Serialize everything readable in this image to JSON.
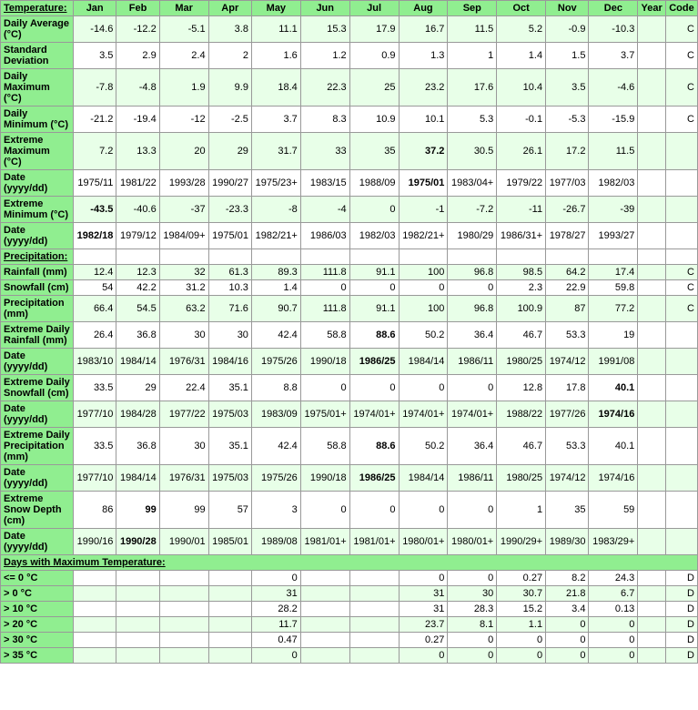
{
  "table": {
    "title": "Temperature:",
    "columns": [
      "Jan",
      "Feb",
      "Mar",
      "Apr",
      "May",
      "Jun",
      "Jul",
      "Aug",
      "Sep",
      "Oct",
      "Nov",
      "Dec",
      "Year",
      "Code"
    ],
    "rows": [
      {
        "label": "Daily Average (°C)",
        "values": [
          "-14.6",
          "-12.2",
          "-5.1",
          "3.8",
          "11.1",
          "15.3",
          "17.9",
          "16.7",
          "11.5",
          "5.2",
          "-0.9",
          "-10.3",
          "",
          "C"
        ],
        "bold": [],
        "bg": "alt"
      },
      {
        "label": "Standard Deviation",
        "values": [
          "3.5",
          "2.9",
          "2.4",
          "2",
          "1.6",
          "1.2",
          "0.9",
          "1.3",
          "1",
          "1.4",
          "1.5",
          "3.7",
          "",
          "C"
        ],
        "bold": [],
        "bg": "normal"
      },
      {
        "label": "Daily Maximum (°C)",
        "values": [
          "-7.8",
          "-4.8",
          "1.9",
          "9.9",
          "18.4",
          "22.3",
          "25",
          "23.2",
          "17.6",
          "10.4",
          "3.5",
          "-4.6",
          "",
          "C"
        ],
        "bold": [],
        "bg": "alt"
      },
      {
        "label": "Daily Minimum (°C)",
        "values": [
          "-21.2",
          "-19.4",
          "-12",
          "-2.5",
          "3.7",
          "8.3",
          "10.9",
          "10.1",
          "5.3",
          "-0.1",
          "-5.3",
          "-15.9",
          "",
          "C"
        ],
        "bold": [],
        "bg": "normal"
      },
      {
        "label": "Extreme Maximum (°C)",
        "values": [
          "7.2",
          "13.3",
          "20",
          "29",
          "31.7",
          "33",
          "35",
          "37.2",
          "30.5",
          "26.1",
          "17.2",
          "11.5",
          "",
          ""
        ],
        "bold": [
          "37.2"
        ],
        "bg": "alt"
      },
      {
        "label": "Date (yyyy/dd)",
        "values": [
          "1975/11",
          "1981/22",
          "1993/28",
          "1990/27",
          "1975/23+",
          "1983/15",
          "1988/09",
          "1975/01",
          "1983/04+",
          "1979/22",
          "1977/03",
          "1982/03",
          "",
          ""
        ],
        "bold": [
          "1975/01"
        ],
        "bg": "normal"
      },
      {
        "label": "Extreme Minimum (°C)",
        "values": [
          "-43.5",
          "-40.6",
          "-37",
          "-23.3",
          "-8",
          "-4",
          "0",
          "-1",
          "-7.2",
          "-11",
          "-26.7",
          "-39",
          "",
          ""
        ],
        "bold": [
          "-43.5"
        ],
        "bg": "alt"
      },
      {
        "label": "Date (yyyy/dd)",
        "values": [
          "1982/18",
          "1979/12",
          "1984/09+",
          "1975/01",
          "1982/21+",
          "1986/03",
          "1982/03",
          "1982/21+",
          "1980/29",
          "1986/31+",
          "1978/27",
          "1993/27",
          "",
          ""
        ],
        "bold": [
          "1982/18"
        ],
        "bg": "normal"
      }
    ],
    "precipitation_title": "Precipitation:",
    "precip_rows": [
      {
        "label": "Rainfall (mm)",
        "values": [
          "12.4",
          "12.3",
          "32",
          "61.3",
          "89.3",
          "111.8",
          "91.1",
          "100",
          "96.8",
          "98.5",
          "64.2",
          "17.4",
          "",
          "C"
        ],
        "bold": [],
        "bg": "alt"
      },
      {
        "label": "Snowfall (cm)",
        "values": [
          "54",
          "42.2",
          "31.2",
          "10.3",
          "1.4",
          "0",
          "0",
          "0",
          "0",
          "2.3",
          "22.9",
          "59.8",
          "",
          "C"
        ],
        "bold": [],
        "bg": "normal"
      },
      {
        "label": "Precipitation (mm)",
        "values": [
          "66.4",
          "54.5",
          "63.2",
          "71.6",
          "90.7",
          "111.8",
          "91.1",
          "100",
          "96.8",
          "100.9",
          "87",
          "77.2",
          "",
          "C"
        ],
        "bold": [],
        "bg": "alt"
      },
      {
        "label": "Extreme Daily Rainfall (mm)",
        "values": [
          "26.4",
          "36.8",
          "30",
          "30",
          "42.4",
          "58.8",
          "88.6",
          "50.2",
          "36.4",
          "46.7",
          "53.3",
          "19",
          "",
          ""
        ],
        "bold": [
          "88.6"
        ],
        "bg": "normal"
      },
      {
        "label": "Date (yyyy/dd)",
        "values": [
          "1983/10",
          "1984/14",
          "1976/31",
          "1984/16",
          "1975/26",
          "1990/18",
          "1986/25",
          "1984/14",
          "1986/11",
          "1980/25",
          "1974/12",
          "1991/08",
          "",
          ""
        ],
        "bold": [
          "1986/25"
        ],
        "bg": "alt"
      },
      {
        "label": "Extreme Daily Snowfall (cm)",
        "values": [
          "33.5",
          "29",
          "22.4",
          "35.1",
          "8.8",
          "0",
          "0",
          "0",
          "0",
          "12.8",
          "17.8",
          "40.1",
          "",
          ""
        ],
        "bold": [
          "40.1"
        ],
        "bg": "normal"
      },
      {
        "label": "Date (yyyy/dd)",
        "values": [
          "1977/10",
          "1984/28",
          "1977/22",
          "1975/03",
          "1983/09",
          "1975/01+",
          "1974/01+",
          "1974/01+",
          "1974/01+",
          "1988/22",
          "1977/26",
          "1974/16",
          "",
          ""
        ],
        "bold": [
          "1974/16"
        ],
        "bg": "alt"
      },
      {
        "label": "Extreme Daily Precipitation (mm)",
        "values": [
          "33.5",
          "36.8",
          "30",
          "35.1",
          "42.4",
          "58.8",
          "88.6",
          "50.2",
          "36.4",
          "46.7",
          "53.3",
          "40.1",
          "",
          ""
        ],
        "bold": [
          "88.6"
        ],
        "bg": "normal"
      },
      {
        "label": "Date (yyyy/dd)",
        "values": [
          "1977/10",
          "1984/14",
          "1976/31",
          "1975/03",
          "1975/26",
          "1990/18",
          "1986/25",
          "1984/14",
          "1986/11",
          "1980/25",
          "1974/12",
          "1974/16",
          "",
          ""
        ],
        "bold": [
          "1986/25"
        ],
        "bg": "alt"
      },
      {
        "label": "Extreme Snow Depth (cm)",
        "values": [
          "86",
          "99",
          "99",
          "57",
          "3",
          "0",
          "0",
          "0",
          "0",
          "1",
          "35",
          "59",
          "",
          ""
        ],
        "bold": [
          "99"
        ],
        "bg": "normal"
      },
      {
        "label": "Date (yyyy/dd)",
        "values": [
          "1990/16",
          "1990/28",
          "1990/01",
          "1985/01",
          "1989/08",
          "1981/01+",
          "1981/01+",
          "1980/01+",
          "1980/01+",
          "1990/29+",
          "1989/30",
          "1983/29+",
          "",
          ""
        ],
        "bold": [
          "1990/28"
        ],
        "bg": "alt"
      }
    ],
    "days_title": "Days with Maximum Temperature:",
    "days_rows": [
      {
        "label": "<= 0 °C",
        "values": [
          "",
          "",
          "",
          "",
          "0",
          "",
          "",
          "0",
          "0",
          "0.27",
          "8.2",
          "24.3",
          "",
          "D"
        ],
        "bold": [],
        "bg": "normal"
      },
      {
        "label": "> 0 °C",
        "values": [
          "",
          "",
          "",
          "",
          "31",
          "",
          "",
          "31",
          "30",
          "30.7",
          "21.8",
          "6.7",
          "",
          "D"
        ],
        "bold": [],
        "bg": "alt"
      },
      {
        "label": "> 10 °C",
        "values": [
          "",
          "",
          "",
          "",
          "28.2",
          "",
          "",
          "31",
          "28.3",
          "15.2",
          "3.4",
          "0.13",
          "",
          "D"
        ],
        "bold": [],
        "bg": "normal"
      },
      {
        "label": "> 20 °C",
        "values": [
          "",
          "",
          "",
          "",
          "11.7",
          "",
          "",
          "23.7",
          "8.1",
          "1.1",
          "0",
          "0",
          "",
          "D"
        ],
        "bold": [],
        "bg": "alt"
      },
      {
        "label": "> 30 °C",
        "values": [
          "",
          "",
          "",
          "",
          "0.47",
          "",
          "",
          "0.27",
          "0",
          "0",
          "0",
          "0",
          "",
          "D"
        ],
        "bold": [],
        "bg": "normal"
      },
      {
        "label": "> 35 °C",
        "values": [
          "",
          "",
          "",
          "",
          "0",
          "",
          "",
          "0",
          "0",
          "0",
          "0",
          "0",
          "",
          "D"
        ],
        "bold": [],
        "bg": "alt"
      }
    ]
  }
}
